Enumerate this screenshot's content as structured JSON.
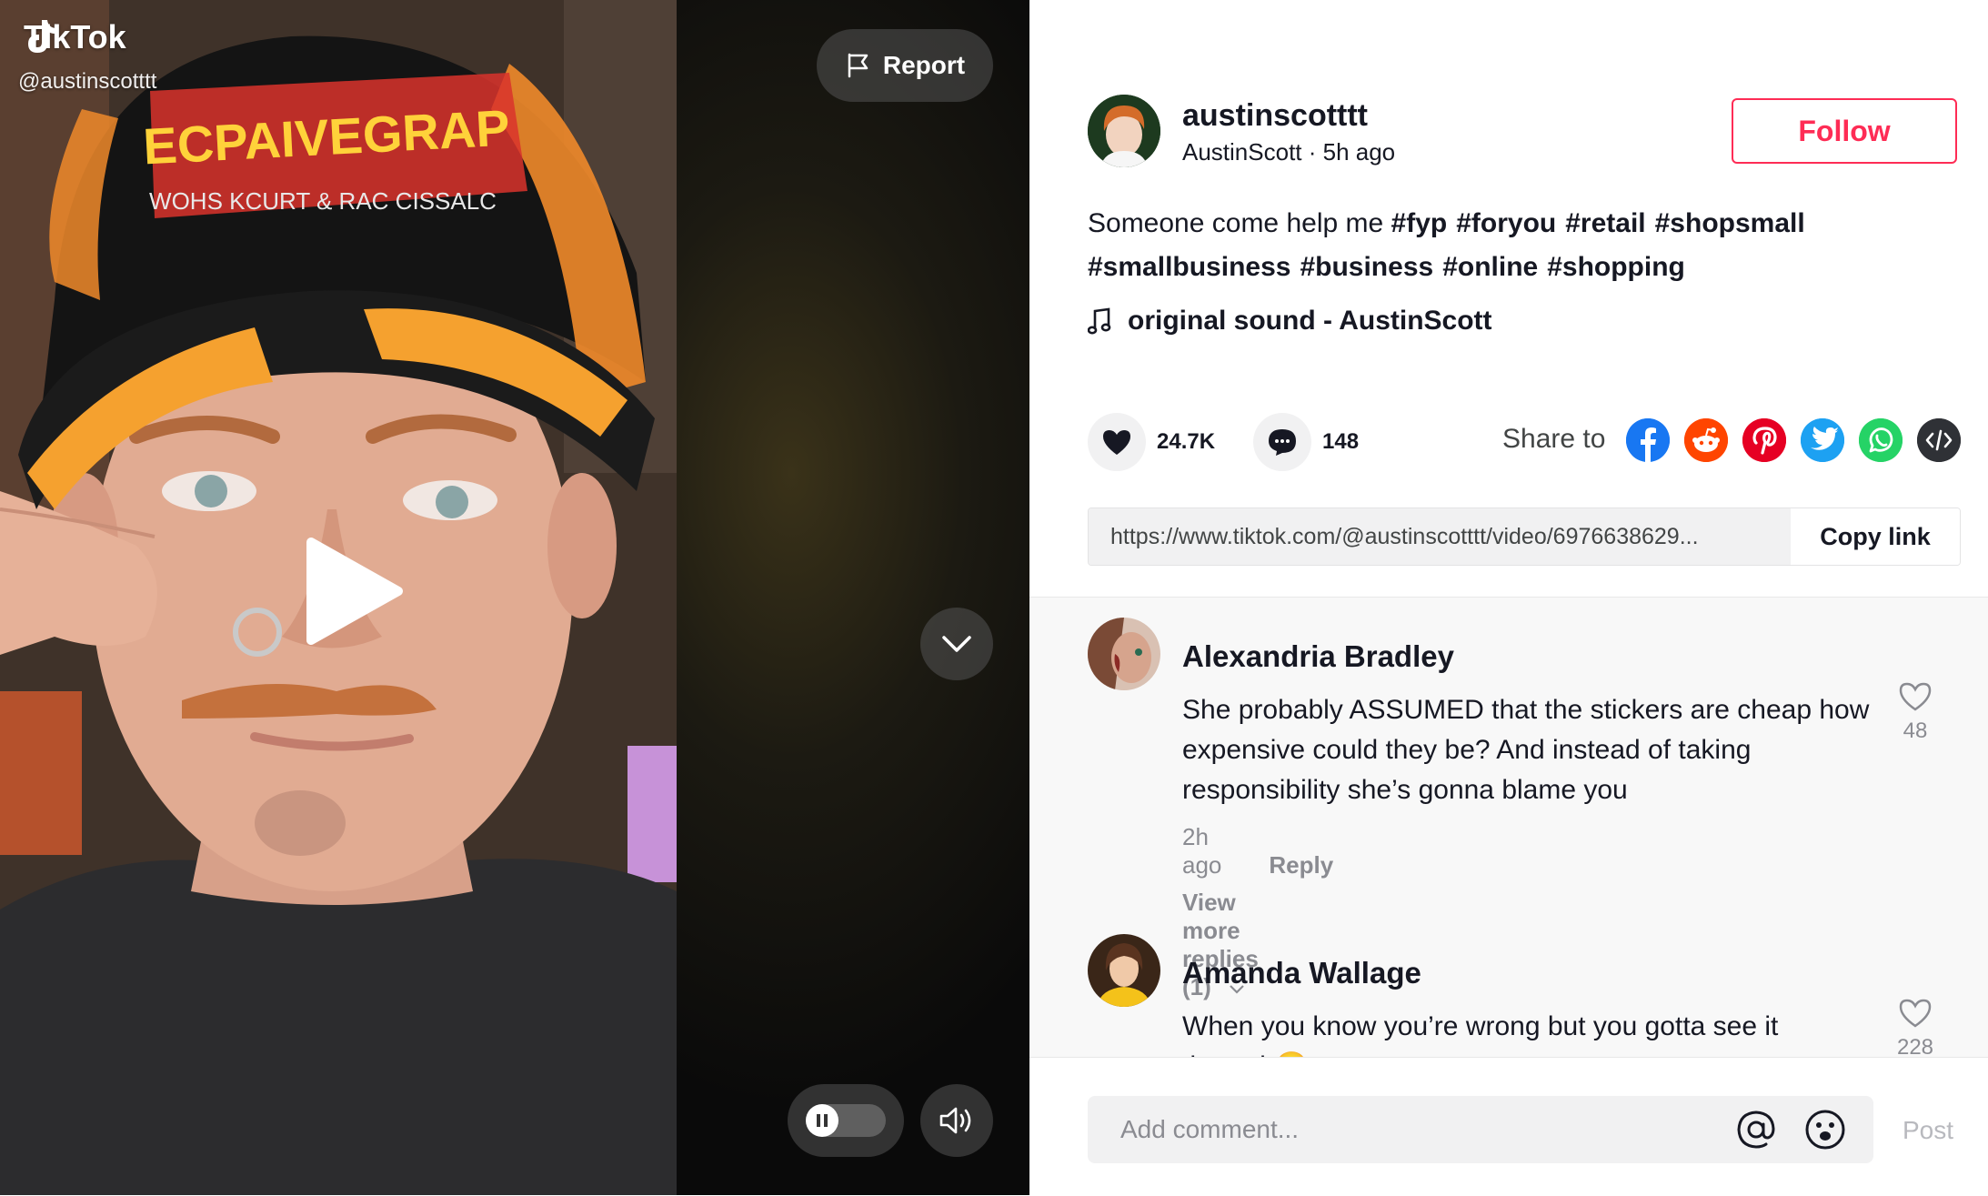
{
  "video": {
    "brand": "TikTok",
    "handle": "@austinscotttt",
    "report_label": "Report"
  },
  "author": {
    "username": "austinscotttt",
    "display_name": "AustinScott",
    "time_ago": "5h ago",
    "subline": "AustinScott · 5h ago",
    "follow_label": "Follow"
  },
  "description": {
    "text": "Someone come help me",
    "hashtags": [
      "#fyp",
      "#foryou",
      "#retail",
      "#shopsmall",
      "#smallbusiness",
      "#business",
      "#online",
      "#shopping"
    ]
  },
  "sound": {
    "label": "original sound - AustinScott"
  },
  "stats": {
    "likes": "24.7K",
    "comments": "148"
  },
  "share": {
    "label": "Share to",
    "targets": [
      "facebook",
      "reddit",
      "pinterest",
      "twitter",
      "whatsapp",
      "embed"
    ]
  },
  "link": {
    "url": "https://www.tiktok.com/@austinscotttt/video/6976638629...",
    "copy_label": "Copy link"
  },
  "comments": [
    {
      "name": "Alexandria Bradley",
      "text": "She probably ASSUMED that the stickers are cheap how expensive could they be? And instead of taking responsibility she’s gonna blame you",
      "time": "2h ago",
      "reply_label": "Reply",
      "likes": "48",
      "more_replies": "View more replies (1)"
    },
    {
      "name": "Amanda Wallage",
      "text": "When you know you’re wrong but you gotta see it through😂",
      "likes": "228"
    }
  ],
  "composer": {
    "placeholder": "Add comment...",
    "post_label": "Post"
  },
  "colors": {
    "accent": "#fe2c55",
    "facebook": "#1877f2",
    "reddit": "#ff4500",
    "pinterest": "#e60023",
    "twitter": "#1da1f2",
    "whatsapp": "#25d366",
    "embed": "#2f3136"
  }
}
